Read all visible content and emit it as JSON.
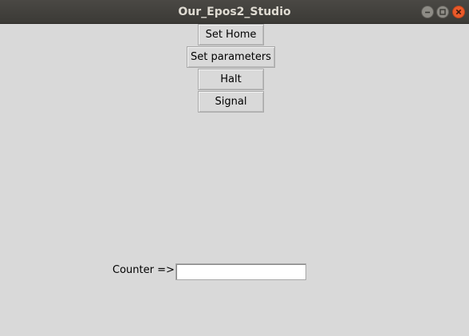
{
  "window": {
    "title": "Our_Epos2_Studio",
    "controls": [
      "minimize-icon",
      "maximize-icon",
      "close-icon"
    ]
  },
  "buttons": {
    "set_home": "Set Home",
    "set_parameters": "Set parameters",
    "halt": "Halt",
    "signal": "Signal"
  },
  "counter": {
    "label": "Counter =>",
    "value": ""
  },
  "colors": {
    "background": "#d9d9d9",
    "titlebar": "#3f3e3a",
    "close_button": "#ea5a2a"
  }
}
